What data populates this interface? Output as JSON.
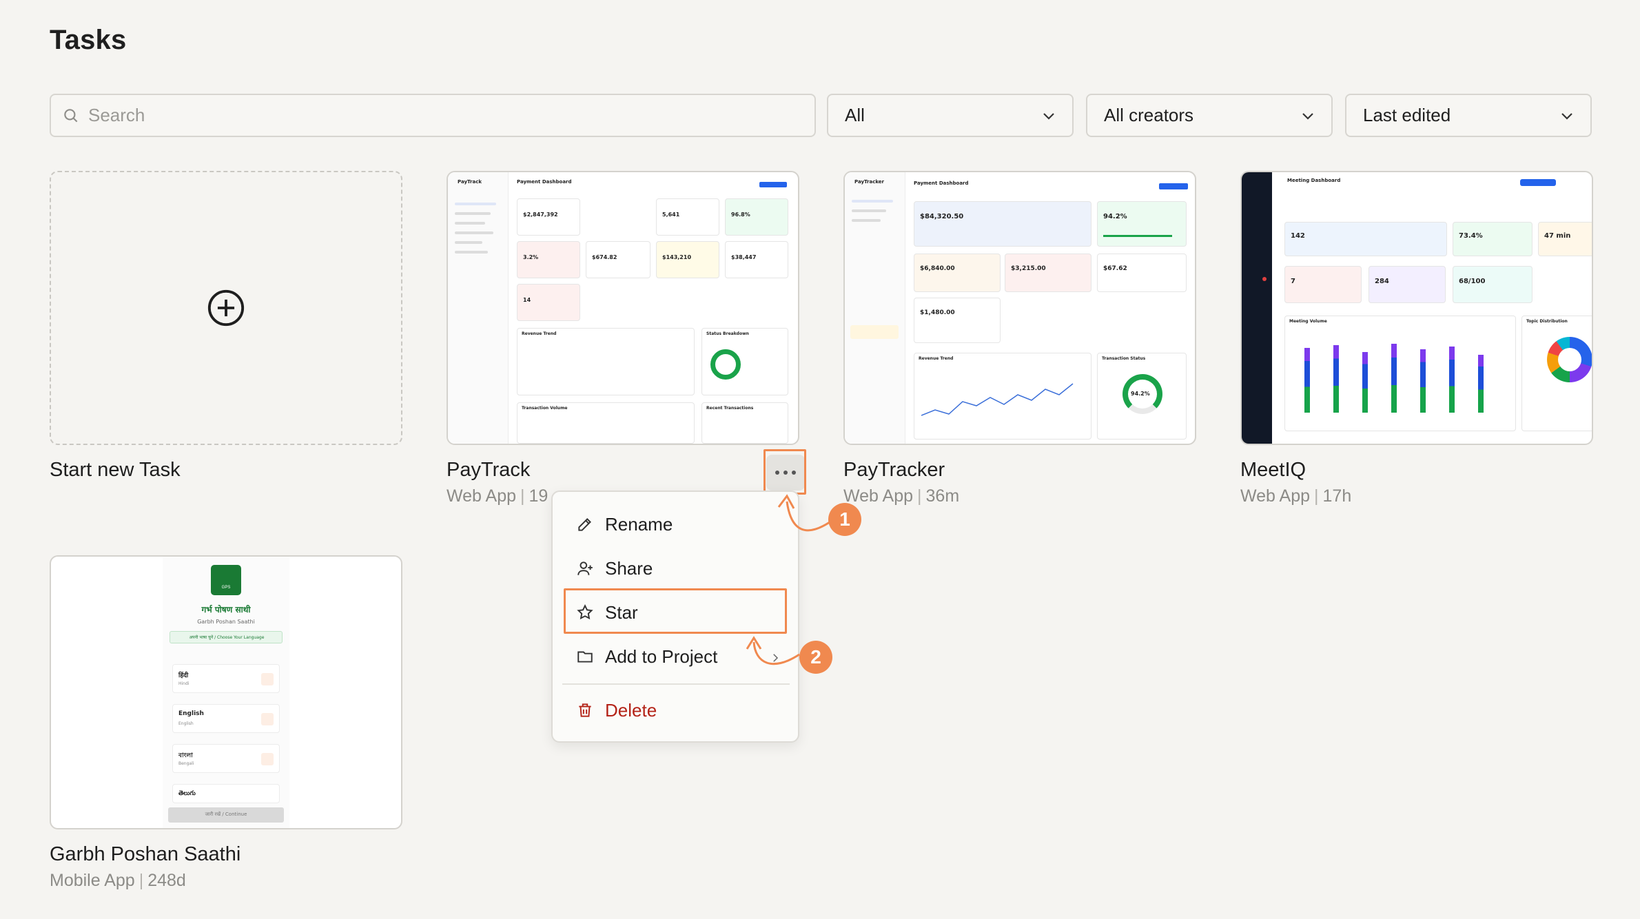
{
  "page": {
    "title": "Tasks"
  },
  "toolbar": {
    "search_placeholder": "Search",
    "type_filter": "All",
    "creator_filter": "All creators",
    "sort": "Last edited"
  },
  "new_task": {
    "label": "Start new Task"
  },
  "tasks": [
    {
      "name": "PayTrack",
      "type": "Web App",
      "age": "19"
    },
    {
      "name": "PayTracker",
      "type": "Web App",
      "age": "36m"
    },
    {
      "name": "MeetIQ",
      "type": "Web App",
      "age": "17h"
    },
    {
      "name": "Garbh Poshan Saathi",
      "type": "Mobile App",
      "age": "248d"
    }
  ],
  "context_menu": {
    "items": [
      "Rename",
      "Share",
      "Star",
      "Add to Project",
      "Delete"
    ]
  },
  "annotations": {
    "step1": "1",
    "step2": "2",
    "accent": "#f0894f"
  },
  "thumbs": {
    "paytrack": {
      "title": "Payment Dashboard",
      "brand": "PayTrack",
      "kpis": [
        "$2,847,392",
        "5,641",
        "96.8%",
        "3.2%",
        "$674.82",
        "$143,210",
        "$38,447",
        "14"
      ],
      "sections": [
        "Revenue Trend",
        "Status Breakdown",
        "Transaction Volume",
        "Recent Transactions"
      ]
    },
    "paytracker": {
      "title": "Payment Dashboard",
      "brand": "PayTracker",
      "kpis": [
        "$84,320.50",
        "94.2%",
        "$6,840.00",
        "$3,215.00",
        "$67.62",
        "$1,480.00"
      ],
      "gauge": "94.2%",
      "sections": [
        "Revenue Trend",
        "Transaction Status"
      ]
    },
    "meetiq": {
      "title": "Meeting Dashboard",
      "kpis": [
        "142",
        "73.4%",
        "47 min",
        "7",
        "284",
        "68/100"
      ],
      "sections": [
        "Meeting Volume",
        "Topic Distribution"
      ]
    },
    "garbh": {
      "title": "गर्भ पोषण साथी",
      "subtitle": "Garbh Poshan Saathi",
      "lang_prompt": "अपनी भाषा चुनें / Choose Your Language",
      "languages": [
        {
          "native": "हिंदी",
          "english": "Hindi"
        },
        {
          "native": "English",
          "english": "English"
        },
        {
          "native": "বাংলা",
          "english": "Bengali"
        },
        {
          "native": "తెలుగు",
          "english": ""
        }
      ],
      "continue": "जारी रखें / Continue",
      "logo_text": "GPS"
    }
  }
}
